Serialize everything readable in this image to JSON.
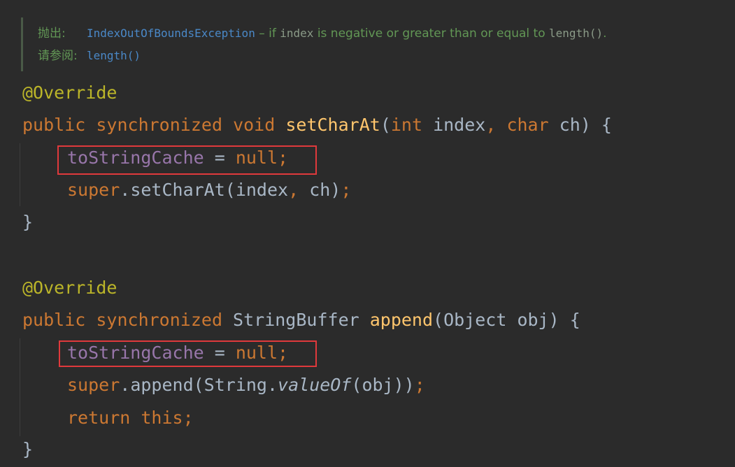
{
  "doc": {
    "throws_label": "抛出:",
    "exception_link": "IndexOutOfBoundsException",
    "desc_prefix": " – if ",
    "desc_param": "index",
    "desc_middle": " is negative or greater than or equal to ",
    "desc_method": "length()",
    "desc_suffix": ".",
    "see_also_label": "请参阅:",
    "see_also_link": "length()"
  },
  "code": {
    "override1": "@Override",
    "m1_public": "public",
    "m1_sync": "synchronized",
    "m1_void": "void",
    "m1_name": "setCharAt",
    "m1_open": "(",
    "m1_int": "int",
    "m1_index": " index",
    "m1_comma": ", ",
    "m1_char": "char",
    "m1_ch": " ch) {",
    "l3_field": "toStringCache",
    "l3_eq": " = ",
    "l3_null": "null",
    "l3_semi": ";",
    "l4_super": "super",
    "l4_call": ".setCharAt(index",
    "l4_comma": ", ",
    "l4_ch": "ch)",
    "l4_semi": ";",
    "close1": "}",
    "override2": "@Override",
    "m2_public": "public",
    "m2_sync": "synchronized",
    "m2_type": " StringBuffer ",
    "m2_name": "append",
    "m2_params": "(Object obj) {",
    "l8_field": "toStringCache",
    "l8_eq": " = ",
    "l8_null": "null",
    "l8_semi": ";",
    "l9_super": "super",
    "l9_call": ".append(String.",
    "l9_valueof": "valueOf",
    "l9_args": "(obj))",
    "l9_semi": ";",
    "l10_return": "return",
    "l10_this": "this",
    "l10_semi": ";",
    "close2": "}"
  },
  "colors": {
    "background": "#2b2b2b",
    "keyword": "#cc7832",
    "annotation": "#bbb529",
    "method": "#ffc66d",
    "field": "#9876aa",
    "text": "#a9b7c6",
    "doc_text": "#629755",
    "doc_link": "#4a88c7",
    "highlight_box": "#e0393c"
  }
}
